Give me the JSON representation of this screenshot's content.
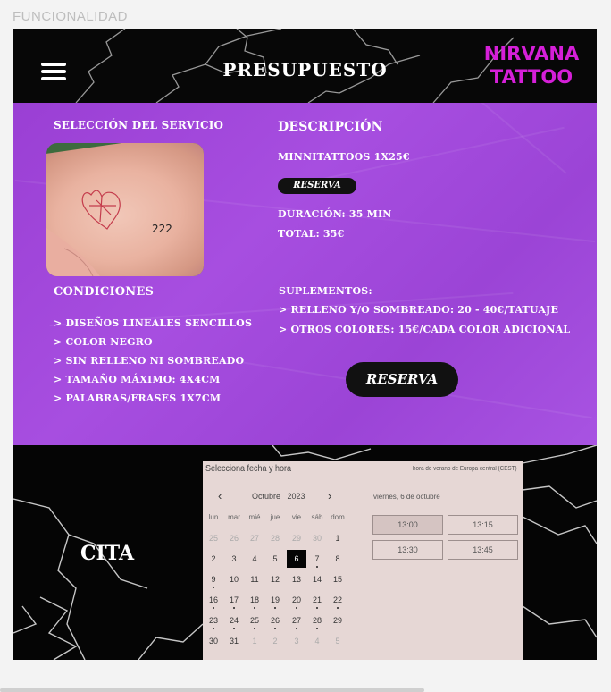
{
  "page": {
    "caption": "FUNCIONALIDAD"
  },
  "header": {
    "title": "PRESUPUESTO",
    "logo_line1": "NIRVANA",
    "logo_line2": "TATTOO"
  },
  "service": {
    "section_label": "SELECCIÓN DEL SERVICIO",
    "description_label": "DESCRIPCIÓN",
    "description": "MINNITATTOOS 1X25€",
    "reserve_small": "RESERVA",
    "duration": "DURACIÓN: 35 MIN",
    "total": "TOTAL: 35€",
    "photo_text": "222"
  },
  "conditions": {
    "title": "CONDICIONES",
    "items": [
      "> DISEÑOS LINEALES SENCILLOS",
      "> COLOR NEGRO",
      "> SIN RELLENO NI SOMBREADO",
      "> TAMAÑO MÁXIMO: 4X4CM",
      "> PALABRAS/FRASES 1X7CM"
    ]
  },
  "supplements": {
    "title": "SUPLEMENTOS:",
    "items": [
      "> RELLENO Y/O SOMBREADO: 20 - 40€/TATUAJE",
      "> OTROS COLORES: 15€/CADA COLOR ADICIONAL"
    ],
    "reserve_big": "RESERVA"
  },
  "cita": {
    "label": "CITA",
    "calendar": {
      "title": "Selecciona fecha y hora",
      "timezone": "hora de verano de Europa central (CEST)",
      "month": "Octubre",
      "year": "2023",
      "weekdays": [
        "lun",
        "mar",
        "mié",
        "jue",
        "vie",
        "sáb",
        "dom"
      ],
      "weeks": [
        [
          "25",
          "26",
          "27",
          "28",
          "29",
          "30",
          "1"
        ],
        [
          "2",
          "3",
          "4",
          "5",
          "6",
          "7",
          "8"
        ],
        [
          "9",
          "10",
          "11",
          "12",
          "13",
          "14",
          "15"
        ],
        [
          "16",
          "17",
          "18",
          "19",
          "20",
          "21",
          "22"
        ],
        [
          "23",
          "24",
          "25",
          "26",
          "27",
          "28",
          "29"
        ],
        [
          "30",
          "31",
          "1",
          "2",
          "3",
          "4",
          "5"
        ]
      ],
      "selected_date_label": "viernes, 6 de octubre",
      "selected_day": "6",
      "slots": [
        "13:00",
        "13:15",
        "13:30",
        "13:45"
      ]
    }
  }
}
